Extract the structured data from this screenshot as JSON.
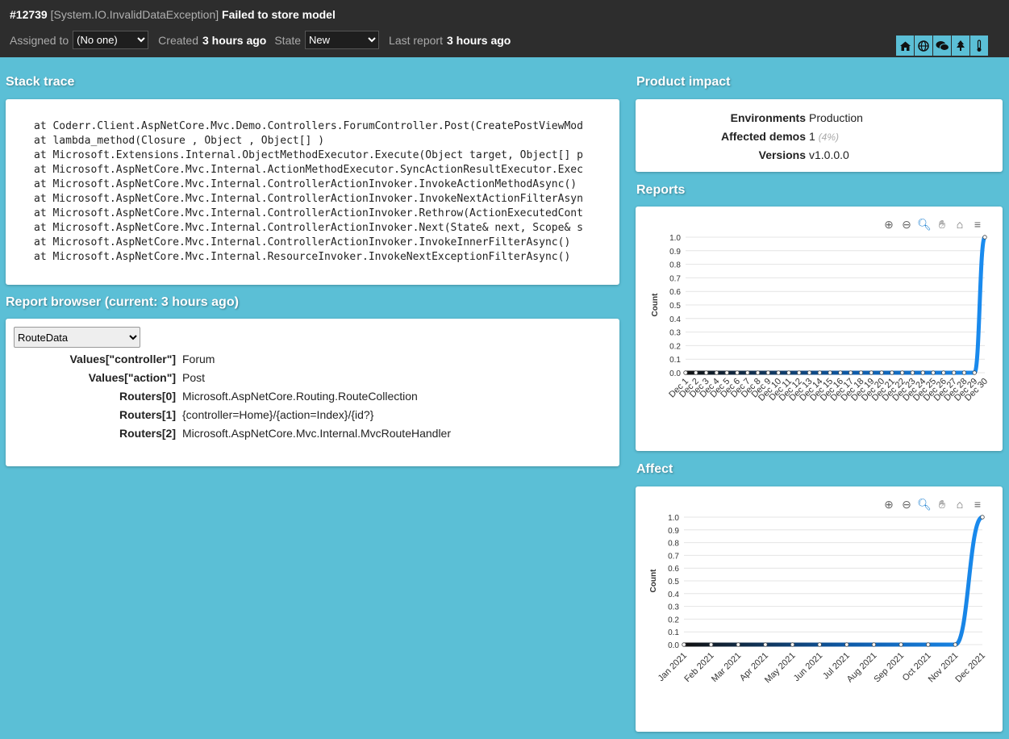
{
  "header": {
    "id": "#12739",
    "exception": "[System.IO.InvalidDataException]",
    "message": "Failed to store model",
    "assigned_label": "Assigned to",
    "assigned_value": "(No one)",
    "created_label": "Created",
    "created_value": "3 hours ago",
    "state_label": "State",
    "state_value": "New",
    "last_report_label": "Last report",
    "last_report_value": "3 hours ago",
    "icons": [
      "home-icon",
      "globe-icon",
      "comments-icon",
      "tree-icon",
      "thermometer-icon"
    ]
  },
  "stack_trace": {
    "title": "Stack trace",
    "lines": [
      "at Coderr.Client.AspNetCore.Mvc.Demo.Controllers.ForumController.Post(CreatePostViewMod",
      "at lambda_method(Closure , Object , Object[] )",
      "at Microsoft.Extensions.Internal.ObjectMethodExecutor.Execute(Object target, Object[] p",
      "at Microsoft.AspNetCore.Mvc.Internal.ActionMethodExecutor.SyncActionResultExecutor.Exec",
      "at Microsoft.AspNetCore.Mvc.Internal.ControllerActionInvoker.InvokeActionMethodAsync()",
      "at Microsoft.AspNetCore.Mvc.Internal.ControllerActionInvoker.InvokeNextActionFilterAsyn",
      "at Microsoft.AspNetCore.Mvc.Internal.ControllerActionInvoker.Rethrow(ActionExecutedCont",
      "at Microsoft.AspNetCore.Mvc.Internal.ControllerActionInvoker.Next(State& next, Scope& s",
      "at Microsoft.AspNetCore.Mvc.Internal.ControllerActionInvoker.InvokeInnerFilterAsync()",
      "at Microsoft.AspNetCore.Mvc.Internal.ResourceInvoker.InvokeNextExceptionFilterAsync()"
    ]
  },
  "report_browser": {
    "title": "Report browser (current: 3 hours ago)",
    "selected_section": "RouteData",
    "rows": [
      {
        "key": "Values[\"controller\"]",
        "value": "Forum"
      },
      {
        "key": "Values[\"action\"]",
        "value": "Post"
      },
      {
        "key": "Routers[0]",
        "value": "Microsoft.AspNetCore.Routing.RouteCollection"
      },
      {
        "key": "Routers[1]",
        "value": "{controller=Home}/{action=Index}/{id?}"
      },
      {
        "key": "Routers[2]",
        "value": "Microsoft.AspNetCore.Mvc.Internal.MvcRouteHandler"
      }
    ]
  },
  "product_impact": {
    "title": "Product impact",
    "environments_label": "Environments",
    "environments_value": "Production",
    "affected_label": "Affected demos",
    "affected_value": "1",
    "affected_pct": "(4%)",
    "versions_label": "Versions",
    "versions_value": "v1.0.0.0"
  },
  "toolbar_icons": [
    "zoom-in-icon",
    "zoom-out-icon",
    "zoom-selection-icon",
    "pan-icon",
    "reset-home-icon",
    "menu-icon"
  ],
  "chart_data": [
    {
      "type": "area",
      "title": "Reports",
      "ylabel": "Count",
      "xlabel": "",
      "ylim": [
        0,
        1.0
      ],
      "yticks": [
        "1.0",
        "0.9",
        "0.8",
        "0.7",
        "0.6",
        "0.5",
        "0.4",
        "0.3",
        "0.2",
        "0.1",
        "0.0"
      ],
      "categories": [
        "Dec 1",
        "Dec 2",
        "Dec 3",
        "Dec 4",
        "Dec 5",
        "Dec 6",
        "Dec 7",
        "Dec 8",
        "Dec 9",
        "Dec 10",
        "Dec 11",
        "Dec 12",
        "Dec 13",
        "Dec 14",
        "Dec 15",
        "Dec 16",
        "Dec 17",
        "Dec 18",
        "Dec 19",
        "Dec 20",
        "Dec 21",
        "Dec 22",
        "Dec 23",
        "Dec 24",
        "Dec 25",
        "Dec 26",
        "Dec 27",
        "Dec 28",
        "Dec 29",
        "Dec 30"
      ],
      "series": [
        {
          "values": [
            0,
            0,
            0,
            0,
            0,
            0,
            0,
            0,
            0,
            0,
            0,
            0,
            0,
            0,
            0,
            0,
            0,
            0,
            0,
            0,
            0,
            0,
            0,
            0,
            0,
            0,
            0,
            0,
            0,
            1
          ]
        }
      ],
      "color": "#1a8cf0",
      "grid": true
    },
    {
      "type": "area",
      "title": "Affect",
      "ylabel": "Count",
      "xlabel": "",
      "ylim": [
        0,
        1.0
      ],
      "yticks": [
        "1.0",
        "0.9",
        "0.8",
        "0.7",
        "0.6",
        "0.5",
        "0.4",
        "0.3",
        "0.2",
        "0.1",
        "0.0"
      ],
      "categories": [
        "Jan 2021",
        "Feb 2021",
        "Mar 2021",
        "Apr 2021",
        "May 2021",
        "Jun 2021",
        "Jul 2021",
        "Aug 2021",
        "Sep 2021",
        "Oct 2021",
        "Nov 2021",
        "Dec 2021"
      ],
      "series": [
        {
          "values": [
            0,
            0,
            0,
            0,
            0,
            0,
            0,
            0,
            0,
            0,
            0,
            1
          ]
        }
      ],
      "color": "#1a8cf0",
      "grid": true
    }
  ]
}
